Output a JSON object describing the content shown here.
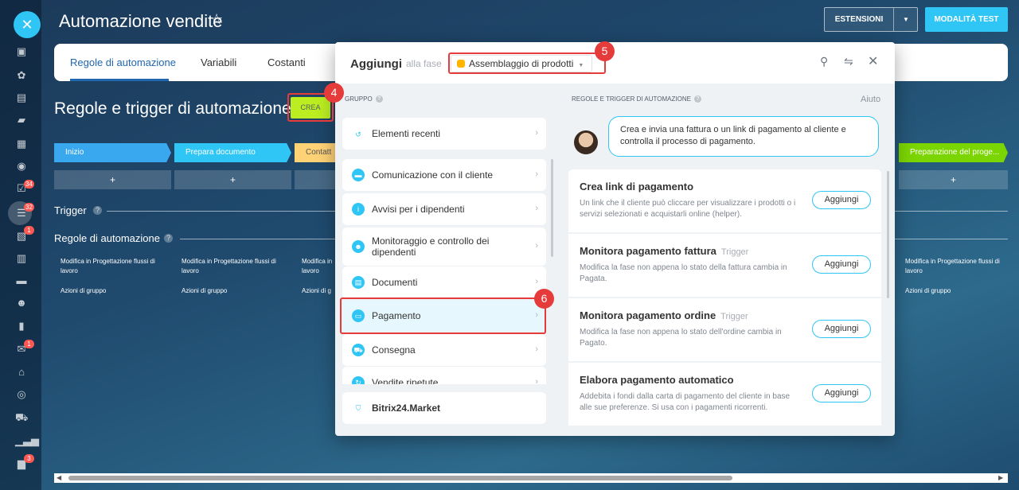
{
  "app": {
    "title": "Automazione vendite",
    "star_icon": "star-icon",
    "extensions_label": "ESTENSIONI",
    "test_mode_label": "MODALITÀ TEST"
  },
  "sidebar": {
    "badges": [
      "34",
      "32",
      "1",
      "1",
      "3"
    ]
  },
  "tabs": [
    {
      "label": "Regole di automazione",
      "active": true
    },
    {
      "label": "Variabili",
      "active": false
    },
    {
      "label": "Costanti",
      "active": false
    }
  ],
  "main": {
    "heading": "Regole e trigger di automazione",
    "create_label": "CREA",
    "stages": [
      {
        "label": "Inizio",
        "color": "#39a8ef"
      },
      {
        "label": "Prepara documento",
        "color": "#2fc6f6"
      },
      {
        "label": "Contatt",
        "color": "#ffd276"
      },
      {
        "label": "Preparazione del proge...",
        "color": "#7bd500"
      }
    ],
    "plus": "+",
    "trigger_label": "Trigger",
    "rules_label": "Regole di automazione",
    "rule_text": "Modifica in Progettazione flussi di lavoro",
    "rule_text_short": "Modifica in",
    "rule_text_short_2": "lavoro",
    "group_actions": "Azioni di gruppo",
    "group_actions_short": "Azioni di g"
  },
  "dialog": {
    "title": "Aggiungi",
    "subtitle": "alla fase",
    "stage_selected": "Assemblaggio di prodotti",
    "group_header": "GRUPPO",
    "rules_header": "REGOLE E TRIGGER DI AUTOMAZIONE",
    "help": "Aiuto",
    "groups": [
      {
        "label": "Elementi recenti",
        "icon": "history-icon"
      },
      {
        "label": "Comunicazione con il cliente",
        "icon": "chat-icon"
      },
      {
        "label": "Avvisi per i dipendenti",
        "icon": "info-icon"
      },
      {
        "label": "Monitoraggio e controllo dei dipendenti",
        "icon": "people-icon"
      },
      {
        "label": "Documenti",
        "icon": "document-icon"
      },
      {
        "label": "Pagamento",
        "icon": "payment-icon"
      },
      {
        "label": "Consegna",
        "icon": "truck-icon"
      },
      {
        "label": "Vendite ripetute",
        "icon": "repeat-icon"
      },
      {
        "label": "Bitrix24.Market",
        "icon": "market-icon"
      }
    ],
    "bubble_text": "Crea e invia una fattura o un link di pagamento al cliente e controlla il processo di pagamento.",
    "add_label": "Aggiungi",
    "rules": [
      {
        "title": "Crea link di pagamento",
        "tag": "",
        "desc": "Un link che il cliente può cliccare per visualizzare i prodotti o i servizi selezionati e acquistarli online (helper)."
      },
      {
        "title": "Monitora pagamento fattura",
        "tag": "Trigger",
        "desc": "Modifica la fase non appena lo stato della fattura cambia in Pagata."
      },
      {
        "title": "Monitora pagamento ordine",
        "tag": "Trigger",
        "desc": "Modifica la fase non appena lo stato dell'ordine cambia in Pagato."
      },
      {
        "title": "Elabora pagamento automatico",
        "tag": "",
        "desc": "Addebita i fondi dalla carta di pagamento del cliente in base alle sue preferenze. Si usa con i pagamenti ricorrenti."
      }
    ]
  },
  "annotations": {
    "marker_4": "4",
    "marker_5": "5",
    "marker_6": "6",
    "color": "#e53b3b"
  },
  "scrollbar": {
    "left_arrow": "◀",
    "right_arrow": "▶"
  }
}
